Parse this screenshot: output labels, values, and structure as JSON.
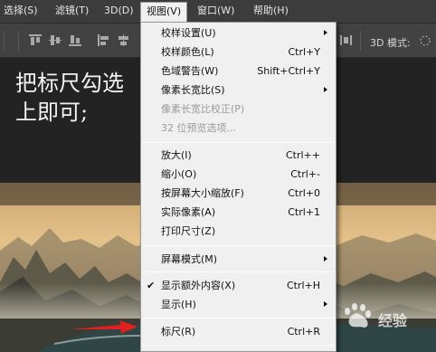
{
  "menubar": {
    "items": [
      {
        "label": "选择(S)"
      },
      {
        "label": "滤镜(T)"
      },
      {
        "label": "3D(D)"
      },
      {
        "label": "视图(V)"
      },
      {
        "label": "窗口(W)"
      },
      {
        "label": "帮助(H)"
      }
    ]
  },
  "options_bar": {
    "mode_label": "3D 模式:"
  },
  "canvas": {
    "caption_line1": "把标尺勾选",
    "caption_line2": "上即可;"
  },
  "view_menu": {
    "items": [
      {
        "label": "校样设置(U)",
        "shortcut": "",
        "submenu": true,
        "disabled": false,
        "checked": false
      },
      {
        "label": "校样颜色(L)",
        "shortcut": "Ctrl+Y",
        "submenu": false,
        "disabled": false,
        "checked": false
      },
      {
        "label": "色域警告(W)",
        "shortcut": "Shift+Ctrl+Y",
        "submenu": false,
        "disabled": false,
        "checked": false
      },
      {
        "label": "像素长宽比(S)",
        "shortcut": "",
        "submenu": true,
        "disabled": false,
        "checked": false
      },
      {
        "label": "像素长宽比校正(P)",
        "shortcut": "",
        "submenu": false,
        "disabled": true,
        "checked": false
      },
      {
        "label": "32 位预览选项...",
        "shortcut": "",
        "submenu": false,
        "disabled": true,
        "checked": false
      },
      {
        "label": "放大(I)",
        "shortcut": "Ctrl++",
        "submenu": false,
        "disabled": false,
        "checked": false
      },
      {
        "label": "缩小(O)",
        "shortcut": "Ctrl+-",
        "submenu": false,
        "disabled": false,
        "checked": false
      },
      {
        "label": "按屏幕大小缩放(F)",
        "shortcut": "Ctrl+0",
        "submenu": false,
        "disabled": false,
        "checked": false
      },
      {
        "label": "实际像素(A)",
        "shortcut": "Ctrl+1",
        "submenu": false,
        "disabled": false,
        "checked": false
      },
      {
        "label": "打印尺寸(Z)",
        "shortcut": "",
        "submenu": false,
        "disabled": false,
        "checked": false
      },
      {
        "label": "屏幕模式(M)",
        "shortcut": "",
        "submenu": true,
        "disabled": false,
        "checked": false
      },
      {
        "label": "显示额外内容(X)",
        "shortcut": "Ctrl+H",
        "submenu": false,
        "disabled": false,
        "checked": true
      },
      {
        "label": "显示(H)",
        "shortcut": "",
        "submenu": true,
        "disabled": false,
        "checked": false
      },
      {
        "label": "标尺(R)",
        "shortcut": "Ctrl+R",
        "submenu": false,
        "disabled": false,
        "checked": false
      }
    ]
  },
  "watermark": {
    "text": "经验"
  }
}
